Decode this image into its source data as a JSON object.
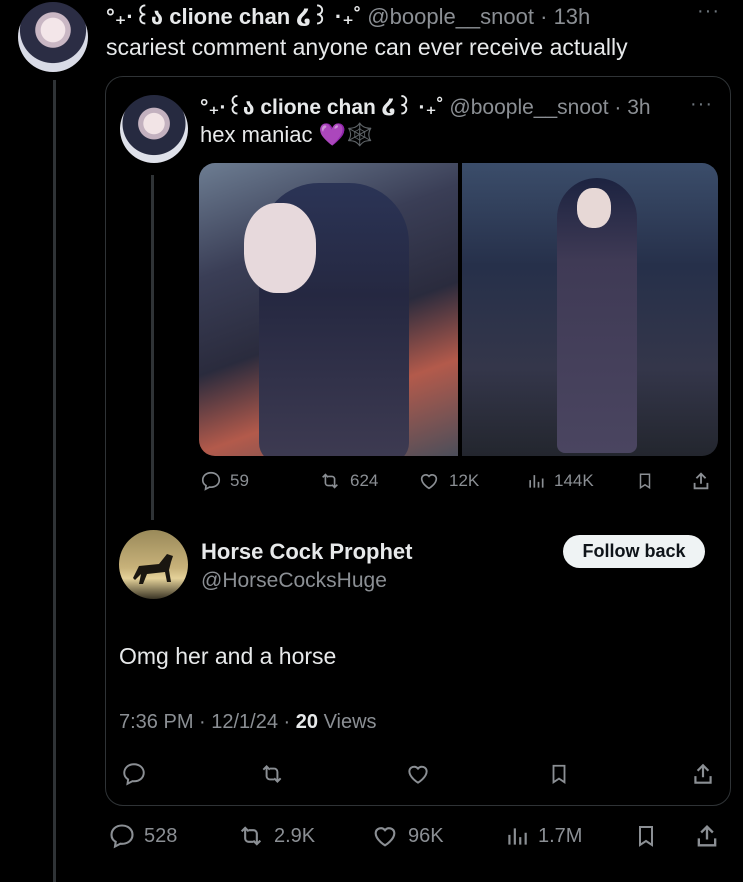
{
  "main_post": {
    "display_name": "°₊·꒰ა clione chan ໒꒱ ·₊˚",
    "handle": "@boople__snoot",
    "time": "13h",
    "text": "scariest comment anyone can ever receive actually",
    "more": "···",
    "actions": {
      "replies": "528",
      "reposts": "2.9K",
      "likes": "96K",
      "views": "1.7M"
    }
  },
  "quoted_post": {
    "display_name": "°₊·꒰ა clione chan ໒꒱ ·₊˚",
    "handle": "@boople__snoot",
    "time": "3h",
    "text": "hex maniac 💜🕸️",
    "more": "···",
    "actions": {
      "replies": "59",
      "reposts": "624",
      "likes": "12K",
      "views": "144K"
    }
  },
  "reply": {
    "display_name": "Horse Cock Prophet",
    "handle": "@HorseCocksHuge",
    "follow_label": "Follow back",
    "text": "Omg her and a horse",
    "timestamp": "7:36 PM · 12/1/24 · ",
    "views_count": "20",
    "views_label": " Views"
  },
  "colors": {
    "background": "#000000",
    "text": "#e7e9ea",
    "muted": "#8b8f94",
    "border": "#2f3336"
  }
}
